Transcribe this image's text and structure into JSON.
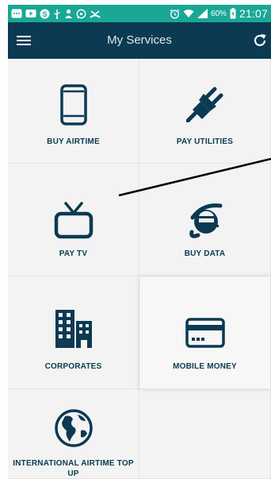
{
  "statusbar": {
    "battery": "60%",
    "time": "21:07"
  },
  "appbar": {
    "title": "My Services"
  },
  "tiles": [
    {
      "label": "BUY AIRTIME"
    },
    {
      "label": "PAY UTILITIES"
    },
    {
      "label": "PAY TV"
    },
    {
      "label": "BUY DATA"
    },
    {
      "label": "CORPORATES"
    },
    {
      "label": "MOBILE MONEY"
    },
    {
      "label": "INTERNATIONAL AIRTIME TOP UP"
    }
  ],
  "colors": {
    "statusbar": "#1aa796",
    "appbar": "#0b3a52",
    "icon": "#0b3a52",
    "tile_bg": "#f3f3f3"
  },
  "icons": {
    "menu": "hamburger-menu-icon",
    "refresh": "refresh-icon",
    "buy_airtime": "smartphone-icon",
    "pay_utilities": "electric-plug-icon",
    "pay_tv": "television-icon",
    "buy_data": "internet-explorer-icon",
    "corporates": "office-building-icon",
    "mobile_money": "credit-card-icon",
    "international": "globe-icon"
  }
}
